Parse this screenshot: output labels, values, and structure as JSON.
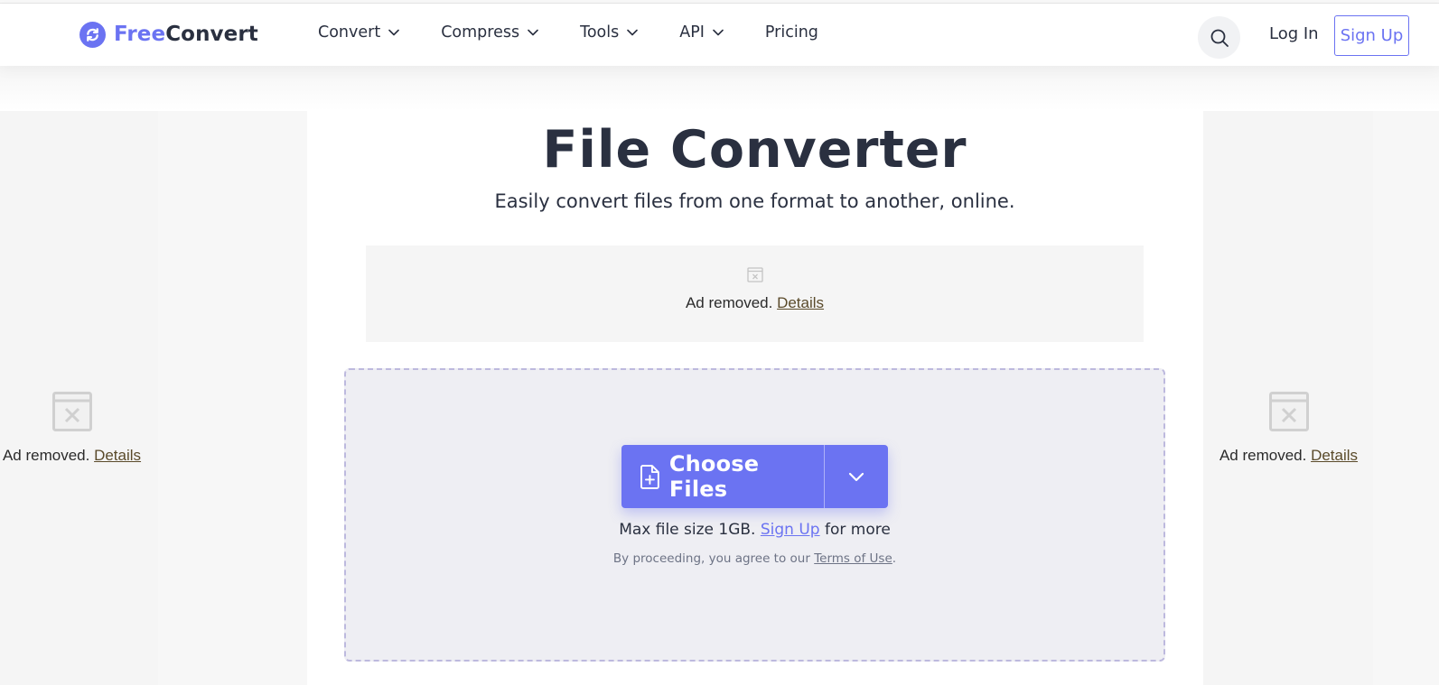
{
  "header": {
    "logo": {
      "part1": "Free",
      "part2": "Convert",
      "icon": "refresh-circle-icon"
    },
    "nav": [
      {
        "label": "Convert",
        "has_dropdown": true
      },
      {
        "label": "Compress",
        "has_dropdown": true
      },
      {
        "label": "Tools",
        "has_dropdown": true
      },
      {
        "label": "API",
        "has_dropdown": true
      },
      {
        "label": "Pricing",
        "has_dropdown": false
      }
    ],
    "search_icon": "search-icon",
    "login_label": "Log In",
    "signup_label": "Sign Up"
  },
  "hero": {
    "title": "File Converter",
    "subtitle": "Easily convert files from one format to another, online."
  },
  "ads": {
    "text": "Ad removed.",
    "details_label": "Details",
    "icon": "ad-placeholder-icon"
  },
  "upload": {
    "choose_label": "Choose Files",
    "choose_icon": "file-plus-icon",
    "dropdown_icon": "chevron-down-icon",
    "max_size_text": "Max file size 1GB.",
    "signup_link": "Sign Up",
    "for_more_text": "for more",
    "terms_prefix": "By proceeding, you agree to our",
    "terms_link": "Terms of Use",
    "terms_suffix": "."
  },
  "colors": {
    "accent": "#6b73f2",
    "text": "#2a3040",
    "dropzone_bg": "#eeeef3",
    "dropzone_border": "#bdb9de"
  }
}
